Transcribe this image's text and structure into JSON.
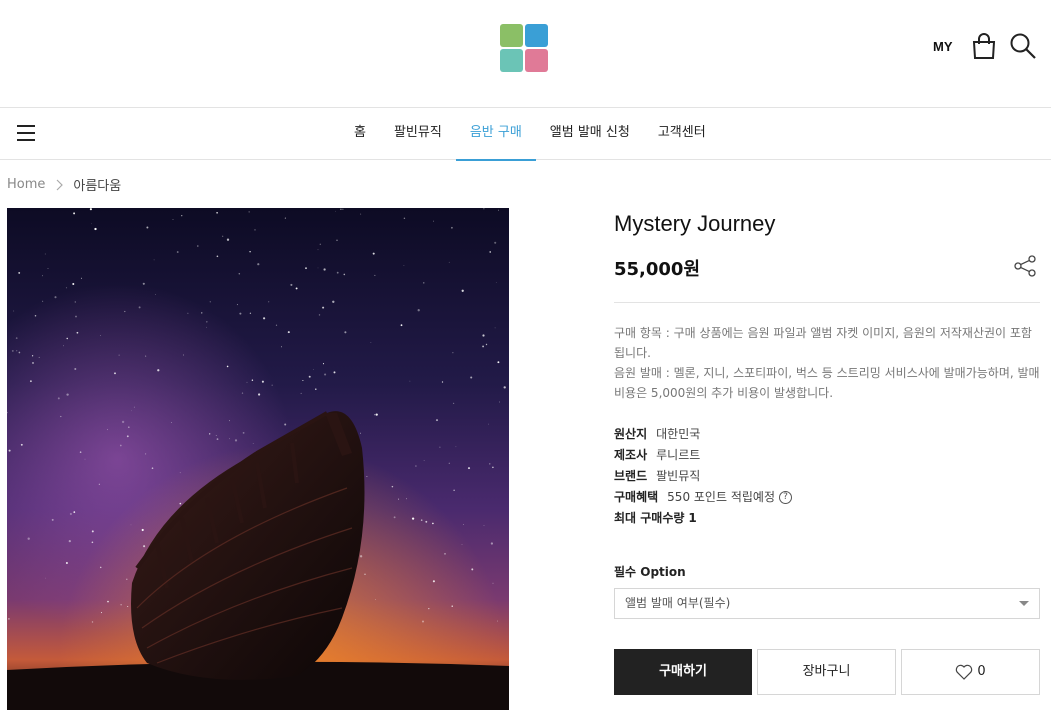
{
  "header": {
    "logo_icon": "four-square-logo",
    "my_label": "MY",
    "bag_icon": "shopping-bag-icon",
    "search_icon": "search-icon"
  },
  "nav": {
    "menu_icon": "hamburger-icon",
    "items": [
      {
        "label": "홈",
        "active": false
      },
      {
        "label": "팔빈뮤직",
        "active": false
      },
      {
        "label": "음반 구매",
        "active": true
      },
      {
        "label": "앨범 발매 신청",
        "active": false
      },
      {
        "label": "고객센터",
        "active": false
      }
    ],
    "active_color": "#3a9fd6"
  },
  "breadcrumb": {
    "home": "Home",
    "separator": ">",
    "current": "아름다움"
  },
  "product": {
    "title": "Mystery Journey",
    "price": "55,000원",
    "description": [
      "구매 항목 : 구매 상품에는 음원 파일과 앨범 자켓 이미지, 음원의 저작재산권이 포함됩니다.",
      "음원 발매 : 멜론, 지니, 스포티파이, 벅스 등 스트리밍 서비스사에 발매가능하며, 발매 비용은 5,000원의 추가 비용이 발생합니다."
    ],
    "specs": [
      {
        "key": "원산지",
        "value": "대한민국"
      },
      {
        "key": "제조사",
        "value": "루니르트"
      },
      {
        "key": "브랜드",
        "value": "팔빈뮤직"
      },
      {
        "key": "구매혜택",
        "value": "550 포인트 적립예정"
      },
      {
        "key": "최대 구매수량",
        "value": "1"
      }
    ],
    "option_label": "필수 Option",
    "option_selected": "앨범 발매 여부(필수)",
    "buy_label": "구매하기",
    "cart_label": "장바구니",
    "like_count": "0"
  }
}
